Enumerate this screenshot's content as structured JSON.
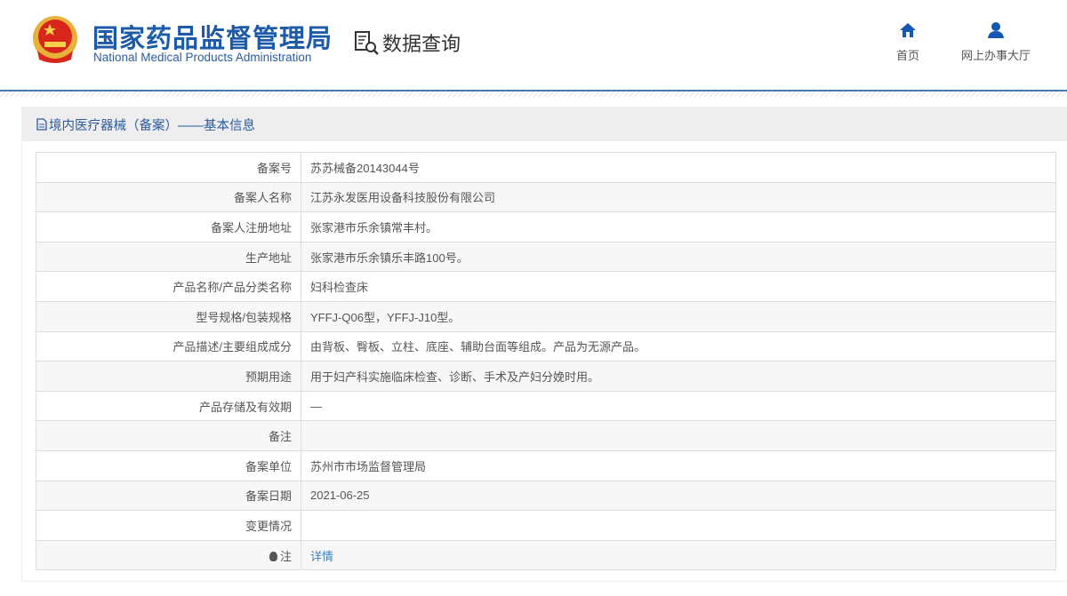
{
  "header": {
    "org_cn": "国家药品监督管理局",
    "org_en": "National Medical Products Administration",
    "section": "数据查询",
    "nav": [
      {
        "label": "首页",
        "icon": "home-icon"
      },
      {
        "label": "网上办事大厅",
        "icon": "user-icon"
      }
    ]
  },
  "panel": {
    "title": "境内医疗器械（备案）——基本信息"
  },
  "rows": [
    {
      "k": "备案号",
      "v": "苏苏械备20143044号"
    },
    {
      "k": "备案人名称",
      "v": "江苏永发医用设备科技股份有限公司"
    },
    {
      "k": "备案人注册地址",
      "v": "张家港市乐余镇常丰村。"
    },
    {
      "k": "生产地址",
      "v": "张家港市乐余镇乐丰路100号。"
    },
    {
      "k": "产品名称/产品分类名称",
      "v": "妇科检查床"
    },
    {
      "k": "型号规格/包装规格",
      "v": "YFFJ-Q06型，YFFJ-J10型。"
    },
    {
      "k": "产品描述/主要组成成分",
      "v": "由背板、臀板、立柱、底座、辅助台面等组成。产品为无源产品。"
    },
    {
      "k": "预期用途",
      "v": "用于妇产科实施临床检查、诊断、手术及产妇分娩时用。"
    },
    {
      "k": "产品存储及有效期",
      "v": "—"
    },
    {
      "k": "备注",
      "v": ""
    },
    {
      "k": "备案单位",
      "v": "苏州市市场监督管理局"
    },
    {
      "k": "备案日期",
      "v": "2021-06-25"
    },
    {
      "k": "变更情况",
      "v": ""
    },
    {
      "k": "注",
      "v": "详情"
    }
  ],
  "colors": {
    "brand": "#1d5aa8",
    "link": "#3b82c4"
  }
}
